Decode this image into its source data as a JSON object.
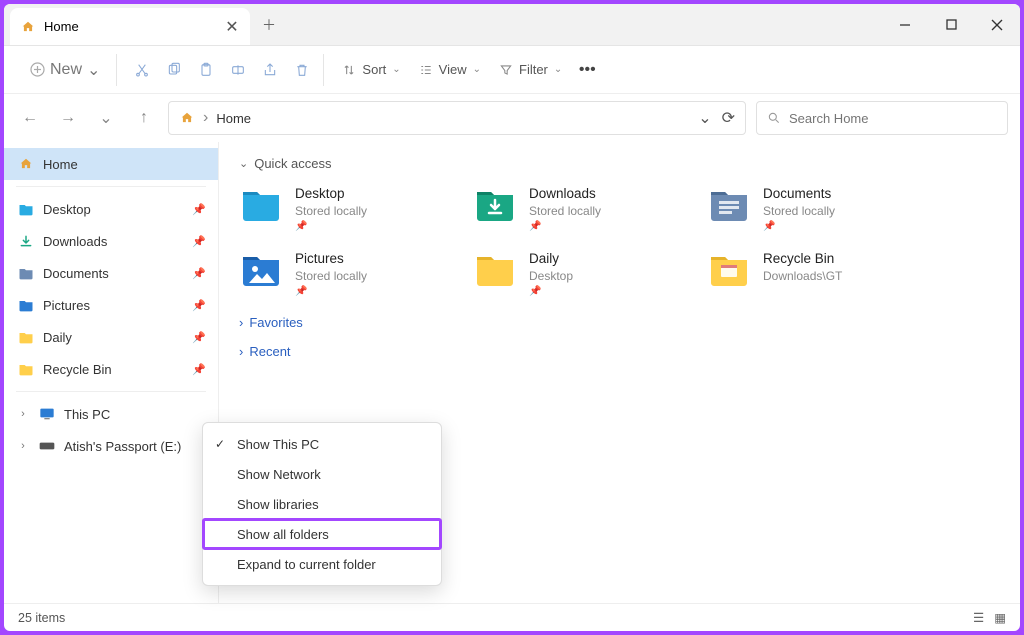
{
  "tab": {
    "title": "Home"
  },
  "toolbar": {
    "new": "New",
    "sort": "Sort",
    "view": "View",
    "filter": "Filter"
  },
  "address": {
    "current": "Home"
  },
  "search": {
    "placeholder": "Search Home"
  },
  "sidebar": {
    "home": "Home",
    "pinned": [
      {
        "label": "Desktop",
        "icon": "desktop"
      },
      {
        "label": "Downloads",
        "icon": "downloads"
      },
      {
        "label": "Documents",
        "icon": "documents"
      },
      {
        "label": "Pictures",
        "icon": "pictures"
      },
      {
        "label": "Daily",
        "icon": "folder"
      },
      {
        "label": "Recycle Bin",
        "icon": "folder"
      }
    ],
    "thispc": "This PC",
    "drive": "Atish's Passport  (E:)"
  },
  "sections": {
    "quick": "Quick access",
    "favorites": "Favorites",
    "recent": "Recent"
  },
  "cards": [
    {
      "name": "Desktop",
      "sub": "Stored locally",
      "icon": "desktop",
      "pinned": true
    },
    {
      "name": "Downloads",
      "sub": "Stored locally",
      "icon": "downloads",
      "pinned": true
    },
    {
      "name": "Documents",
      "sub": "Stored locally",
      "icon": "documents",
      "pinned": true
    },
    {
      "name": "Pictures",
      "sub": "Stored locally",
      "icon": "pictures",
      "pinned": true
    },
    {
      "name": "Daily",
      "sub": "Desktop",
      "icon": "folder",
      "pinned": true
    },
    {
      "name": "Recycle Bin",
      "sub": "Downloads\\GT",
      "icon": "recycle",
      "pinned": false
    }
  ],
  "context_menu": [
    {
      "label": "Show This PC",
      "checked": true
    },
    {
      "label": "Show Network"
    },
    {
      "label": "Show libraries"
    },
    {
      "label": "Show all folders",
      "highlight": true
    },
    {
      "label": "Expand to current folder"
    }
  ],
  "status": {
    "count": "25 items"
  }
}
